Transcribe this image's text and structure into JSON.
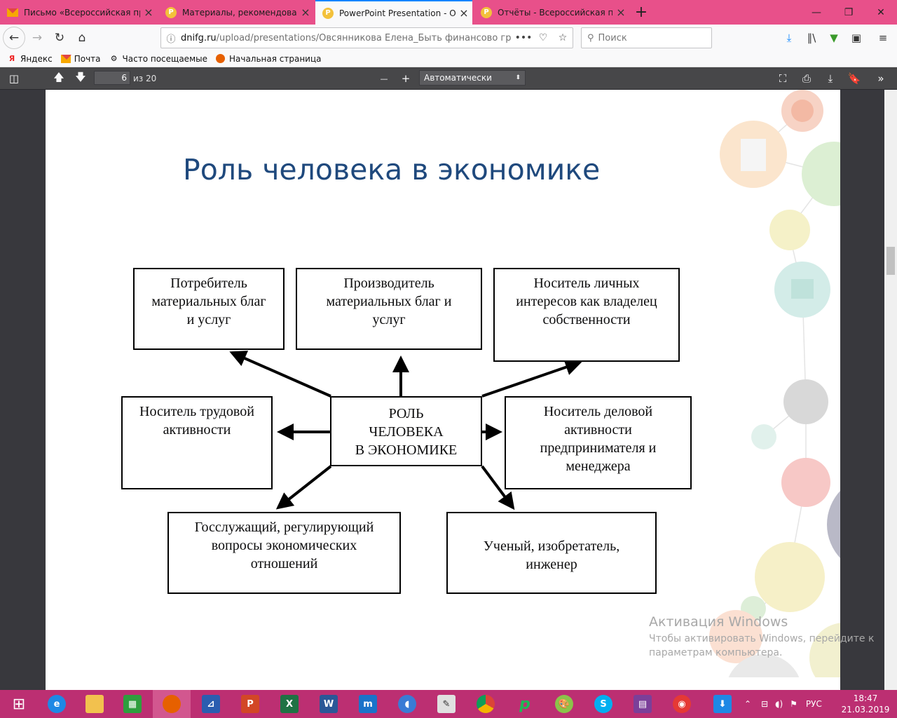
{
  "tabs": [
    {
      "label": "Письмо «Всероссийская про",
      "icon": "mail-icon",
      "active": false
    },
    {
      "label": "Материалы, рекомендованн",
      "icon": "p-icon",
      "active": false
    },
    {
      "label": "PowerPoint Presentation - Овс",
      "icon": "p-icon",
      "active": true
    },
    {
      "label": "Отчёты - Всероссийская про",
      "icon": "p-icon",
      "active": false
    }
  ],
  "url": {
    "host": "dnifg.ru",
    "path": "/upload/presentations/Овсянникова Елена_Быть финансово гр"
  },
  "search": {
    "placeholder": "Поиск"
  },
  "bookmarks": [
    {
      "label": "Яндекс",
      "icon": "yandex-icon"
    },
    {
      "label": "Почта",
      "icon": "mail-icon"
    },
    {
      "label": "Часто посещаемые",
      "icon": "gear-icon"
    },
    {
      "label": "Начальная страница",
      "icon": "firefox-icon"
    }
  ],
  "pdf": {
    "page": "6",
    "of": "из 20",
    "zoom": "Автоматически",
    "zoom_minus": "—",
    "zoom_plus": "+"
  },
  "slide": {
    "title": "Роль человека в экономике",
    "center": "РОЛЬ\nЧЕЛОВЕКА\nВ ЭКОНОМИКЕ",
    "roles": [
      "Потребитель\nматериальных благ\nи услуг",
      "Производитель\nматериальных благ и\nуслуг",
      "Носитель личных\nинтересов как владелец\nсобственности",
      "Носитель трудовой\nактивности",
      "Носитель деловой\nактивности\nпредпринимателя и\nменеджера",
      "Госслужащий, регулирующий\nвопросы экономических\nотношений",
      "Ученый, изобретатель,\nинженер"
    ]
  },
  "watermark": {
    "title": "Активация Windows",
    "text": "Чтобы активировать Windows, перейдите к параметрам компьютера."
  },
  "tray": {
    "lang": "РУС",
    "time": "18:47",
    "date": "21.03.2019"
  },
  "colors": {
    "tabstrip": "#e8508a",
    "taskbar": "#bc2f72",
    "slide_title": "#1f497d",
    "accent": "#0a84ff"
  }
}
